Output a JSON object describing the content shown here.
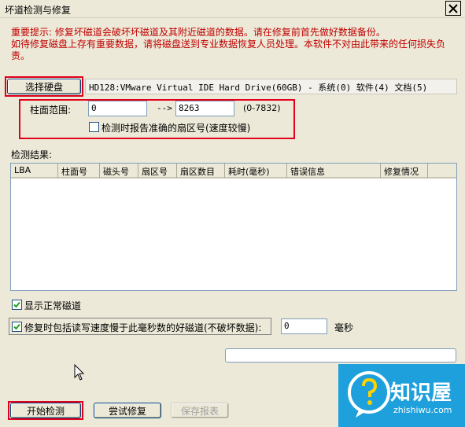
{
  "window": {
    "title": "坏道检测与修复",
    "close_icon": "close-icon"
  },
  "warning": {
    "text": "重要提示: 修复坏磁道会破坏坏磁道及其附近磁道的数据。请在修复前首先做好数据备份。\n如待修复磁盘上存有重要数据，请将磁盘送到专业数据恢复人员处理。本软件不对由此带来的任何损失负\n责。",
    "color": "#c00000"
  },
  "disk": {
    "select_label": "选择硬盘",
    "info": "HD128:VMware Virtual IDE Hard Drive(60GB) - 系统(0) 软件(4) 文档(5)"
  },
  "cylinder": {
    "label": "柱面范围:",
    "from": "0",
    "arrow": "-->",
    "to": "8263",
    "range": "(0-7832)",
    "report_sector_label": "检测时报告准确的扇区号(速度较慢)",
    "report_sector_checked": false
  },
  "results": {
    "label": "检测结果:",
    "columns": [
      "LBA",
      "柱面号",
      "磁头号",
      "扇区号",
      "扇区数目",
      "耗时(毫秒)",
      "错误信息",
      "修复情况"
    ]
  },
  "options": {
    "show_normal_label": "显示正常磁道",
    "show_normal_checked": true,
    "repair_slow_label": "修复时包括读写速度慢于此毫秒数的好磁道(不破坏数据):",
    "repair_slow_checked": true,
    "ms_value": "0",
    "ms_unit": "毫秒"
  },
  "progress": {
    "value": 0
  },
  "buttons": {
    "start": "开始检测",
    "try_repair": "尝试修复",
    "save_report": "保存报表"
  },
  "watermark": {
    "brand": "知识屋",
    "url": "zhishiwu.com",
    "color": "#1ea0dc"
  }
}
